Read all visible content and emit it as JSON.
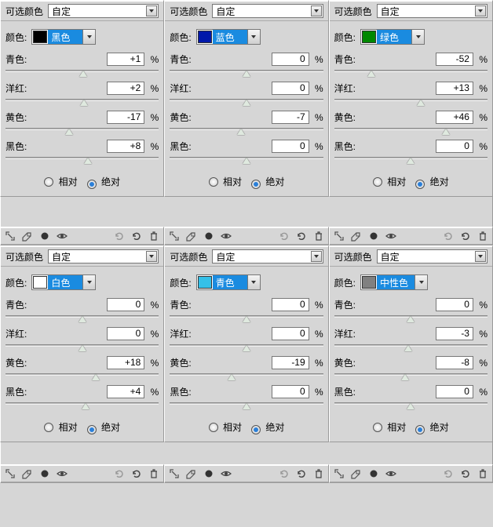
{
  "labels": {
    "selective_color": "可选颜色",
    "custom": "自定",
    "color_label": "颜色:",
    "cyan": "青色:",
    "magenta": "洋红:",
    "yellow": "黄色:",
    "black": "黑色:",
    "relative": "相对",
    "absolute": "绝对",
    "percent": "%"
  },
  "panels": [
    {
      "color_name": "黑色",
      "swatch": "#000000",
      "values": {
        "cyan": "+1",
        "magenta": "+2",
        "yellow": "-17",
        "black": "+8"
      },
      "mode": "absolute"
    },
    {
      "color_name": "蓝色",
      "swatch": "#0018aa",
      "values": {
        "cyan": "0",
        "magenta": "0",
        "yellow": "-7",
        "black": "0"
      },
      "mode": "absolute"
    },
    {
      "color_name": "绿色",
      "swatch": "#008800",
      "values": {
        "cyan": "-52",
        "magenta": "+13",
        "yellow": "+46",
        "black": "0"
      },
      "mode": "absolute"
    },
    {
      "color_name": "白色",
      "swatch": "#ffffff",
      "values": {
        "cyan": "0",
        "magenta": "0",
        "yellow": "+18",
        "black": "+4"
      },
      "mode": "absolute"
    },
    {
      "color_name": "青色",
      "swatch": "#35c0e8",
      "values": {
        "cyan": "0",
        "magenta": "0",
        "yellow": "-19",
        "black": "0"
      },
      "mode": "absolute"
    },
    {
      "color_name": "中性色",
      "swatch": "#808080",
      "values": {
        "cyan": "0",
        "magenta": "-3",
        "yellow": "-8",
        "black": "0"
      },
      "mode": "absolute"
    }
  ]
}
